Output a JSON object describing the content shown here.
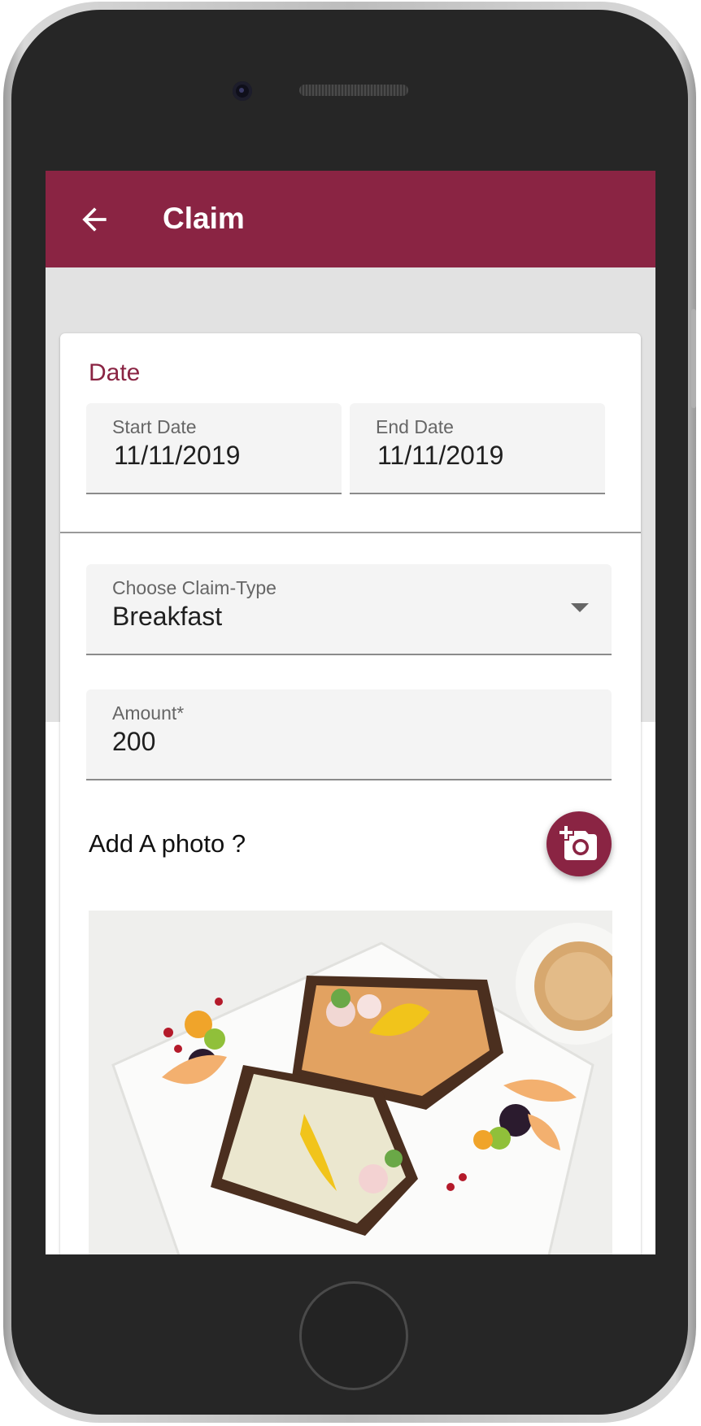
{
  "app_bar": {
    "title": "Claim",
    "back_icon": "arrow-left-icon",
    "color": "#8a2443"
  },
  "date_section": {
    "title": "Date",
    "start_date": {
      "label": "Start Date",
      "value": "11/11/2019"
    },
    "end_date": {
      "label": "End Date",
      "value": "11/11/2019"
    }
  },
  "claim_type": {
    "label": "Choose Claim-Type",
    "value": "Breakfast",
    "icon": "dropdown-arrow-icon"
  },
  "amount": {
    "label": "Amount*",
    "value": "200"
  },
  "photo": {
    "label": "Add A photo ?",
    "button_icon": "add-photo-icon",
    "image": "breakfast-photo"
  }
}
